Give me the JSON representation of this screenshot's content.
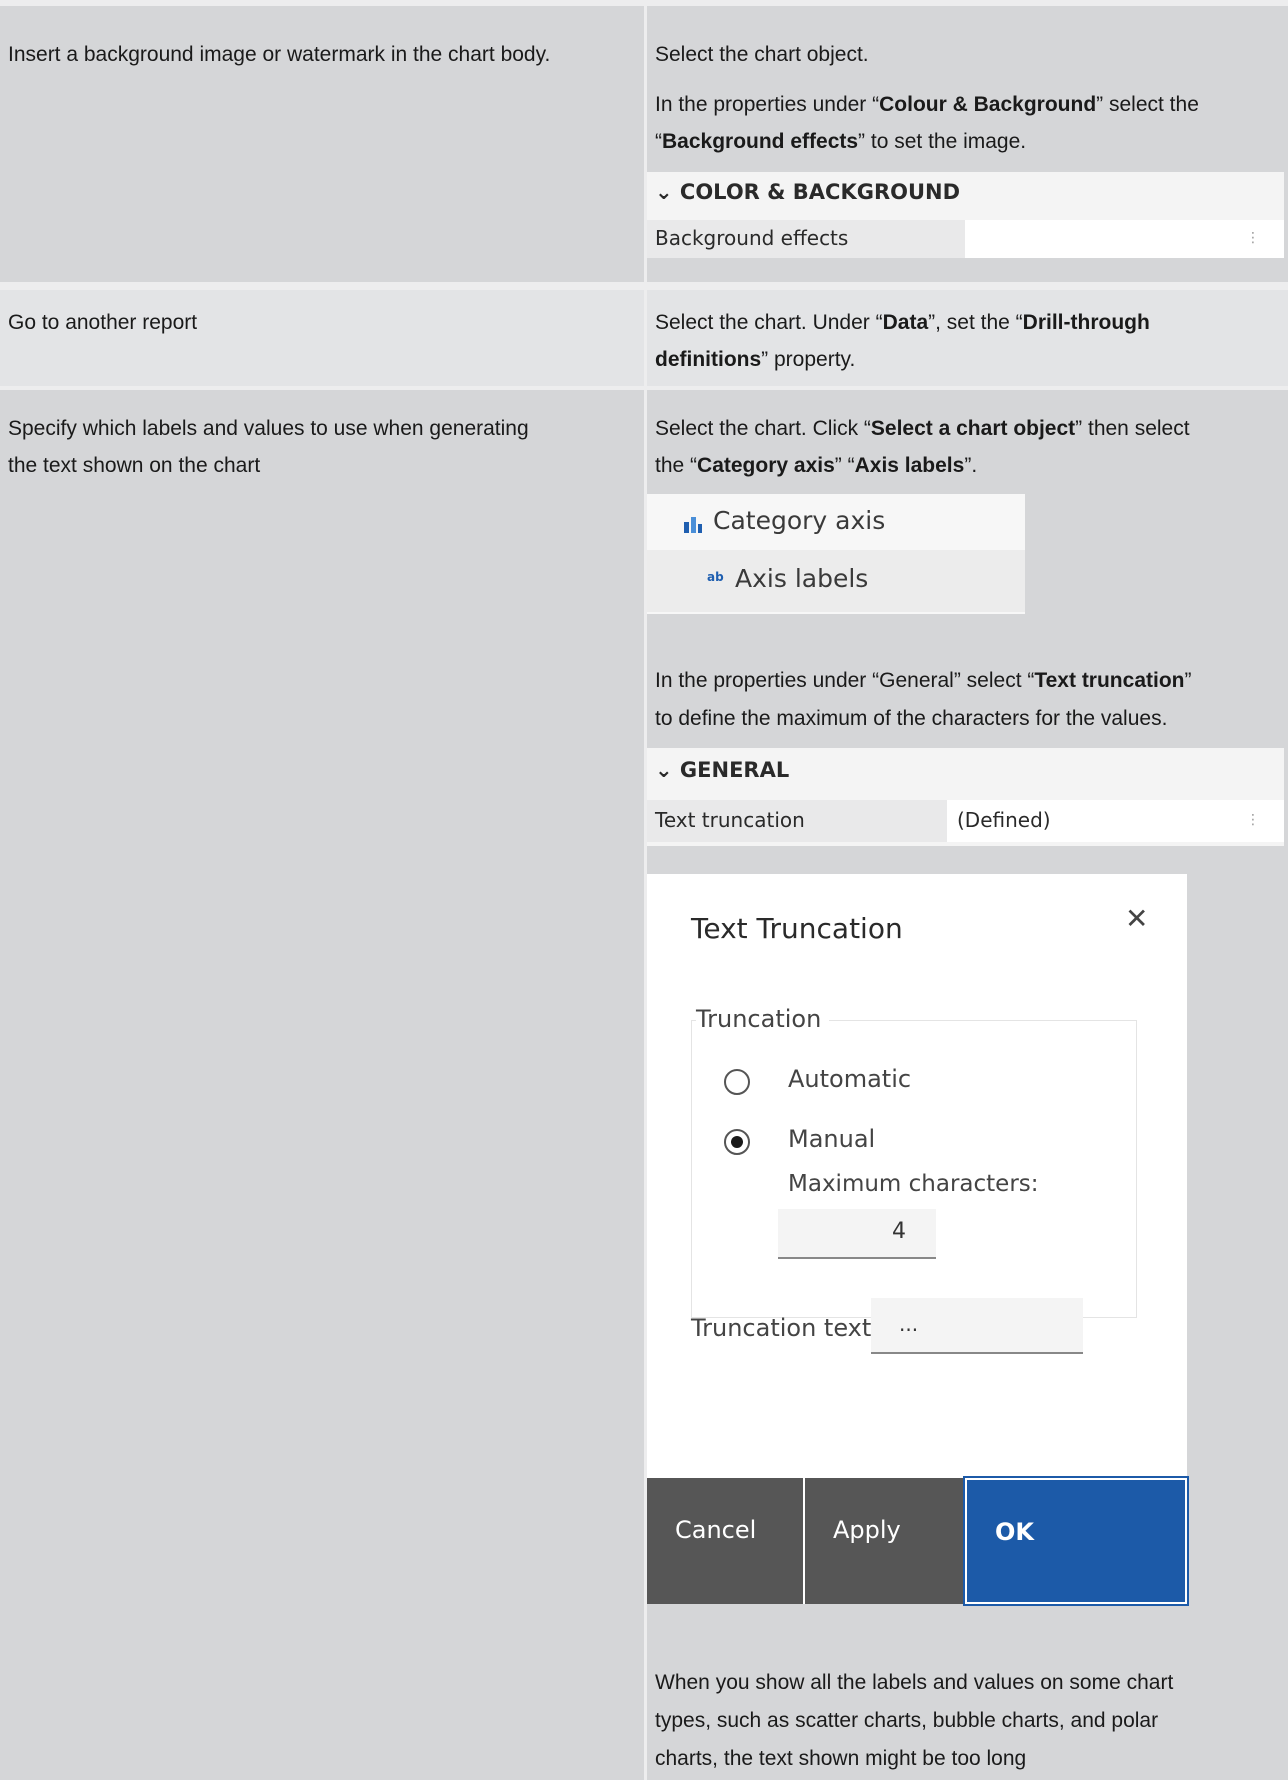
{
  "rows": [
    {
      "task": "Insert a background image or watermark in the chart body.",
      "steps": [
        {
          "parts": [
            "Select the chart object."
          ]
        },
        {
          "parts": [
            "In the properties under “",
            "Colour & Background",
            "” select the"
          ]
        },
        {
          "parts": [
            "“",
            "Background effects",
            "” to set the image."
          ]
        }
      ],
      "panel": {
        "section": "COLOR & BACKGROUND",
        "property": "Background effects",
        "value": ""
      }
    },
    {
      "task": "Go to another report",
      "steps": [
        {
          "parts": [
            "Select the chart. Under “",
            "Data",
            "”, set the “",
            "Drill-through"
          ]
        },
        {
          "parts": [
            "",
            "definitions",
            "” property."
          ]
        }
      ]
    },
    {
      "task_lines": [
        "Specify which labels and values to use when generating",
        "the text shown on the chart"
      ],
      "steps": [
        {
          "parts": [
            "Select the chart. Click “",
            "Select a chart object",
            "” then select"
          ]
        },
        {
          "parts": [
            "the “",
            "Category axis",
            "” “",
            "Axis labels",
            "”."
          ]
        }
      ],
      "tree": {
        "item1": "Category axis",
        "item2": "Axis labels"
      },
      "steps2": [
        {
          "parts": [
            "In the properties under “General” select “",
            "Text truncation",
            "”"
          ]
        },
        {
          "parts": [
            "to define the maximum of the characters for the values."
          ]
        }
      ],
      "panel2": {
        "section": "GENERAL",
        "property": "Text truncation",
        "value": "(Defined)"
      },
      "dialog": {
        "title": "Text Truncation",
        "group": "Truncation",
        "option_auto": "Automatic",
        "option_manual": "Manual",
        "selected": "Manual",
        "max_label": "Maximum characters:",
        "max_value": "4",
        "trunc_label": "Truncation text:",
        "trunc_value": "...",
        "cancel": "Cancel",
        "apply": "Apply",
        "ok": "OK"
      },
      "note_lines": [
        "When you show all the labels and values on some chart",
        "types, such as scatter charts, bubble charts, and polar",
        "charts, the text shown might be too long"
      ]
    }
  ],
  "colors": {
    "ok_button": "#1c5aa8",
    "dark_button": "#565656",
    "row_light": "#e3e4e6",
    "row_dark": "#d5d6d8"
  }
}
